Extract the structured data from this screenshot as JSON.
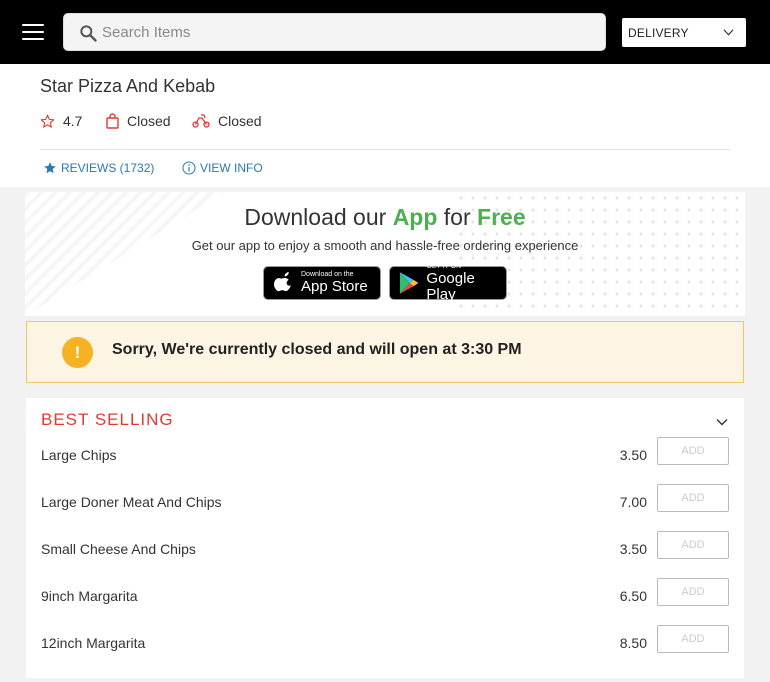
{
  "topbar": {
    "search_placeholder": "Search Items",
    "order_type": "DELIVERY"
  },
  "store": {
    "name": "Star Pizza And Kebab",
    "rating": "4.7",
    "collection_status": "Closed",
    "delivery_status": "Closed",
    "reviews_link": "REVIEWS (1732)",
    "info_link": "VIEW INFO"
  },
  "banner": {
    "title_pre": "Download our ",
    "title_app": "App",
    "title_mid": " for ",
    "title_free": "Free",
    "subtitle": "Get our app to enjoy a smooth and hassle-free ordering experience",
    "appstore_small": "Download on the",
    "appstore_big": "App Store",
    "googleplay_small": "GET IT ON",
    "googleplay_big": "Google Play"
  },
  "notice": {
    "icon": "!",
    "text": "Sorry, We're currently closed and will open at 3:30 PM"
  },
  "best_selling": {
    "title": "BEST SELLING",
    "add_label": "ADD",
    "items": [
      {
        "name": "Large Chips",
        "price": "3.50"
      },
      {
        "name": "Large Doner Meat And Chips",
        "price": "7.00"
      },
      {
        "name": "Small Cheese And Chips",
        "price": "3.50"
      },
      {
        "name": "9inch Margarita",
        "price": "6.50"
      },
      {
        "name": "12inch Margarita",
        "price": "8.50"
      }
    ]
  },
  "colors": {
    "accent_red": "#e23a32",
    "accent_green": "#4caf50",
    "link_blue": "#2a7ab0",
    "notice_bg": "#fdf5e3",
    "notice_icon": "#f5b324"
  }
}
